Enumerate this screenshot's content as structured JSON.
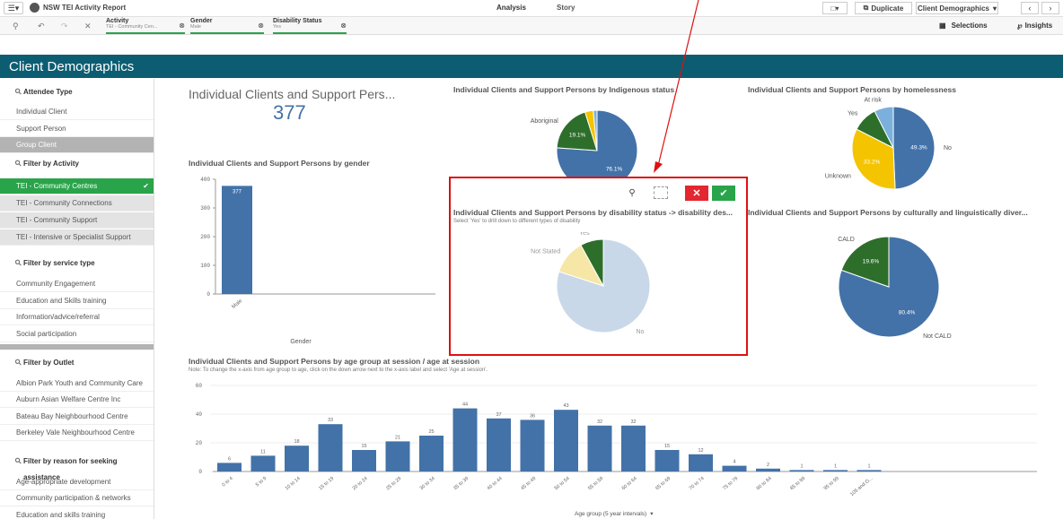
{
  "app": {
    "title": "NSW TEI Activity Report"
  },
  "nav": {
    "tabs": [
      "Analysis",
      "Story"
    ],
    "duplicate": "Duplicate",
    "sheet": "Client Demographics",
    "selections": "Selections",
    "insights": "Insights"
  },
  "selections": [
    {
      "field": "Activity",
      "value": "TEI - Community Cen..."
    },
    {
      "field": "Gender",
      "value": "Male"
    },
    {
      "field": "Disability Status",
      "value": "Yes"
    }
  ],
  "sheet_title": "Client Demographics",
  "sidebar": {
    "attendee_type": {
      "header": "Attendee Type",
      "items": [
        "Individual Client",
        "Support Person",
        "Group Client"
      ]
    },
    "activity": {
      "header": "Filter by Activity",
      "items": [
        "TEI - Community Centres",
        "TEI - Community Connections",
        "TEI - Community Support",
        "TEI - Intensive or Specialist Support"
      ]
    },
    "service_type": {
      "header": "Filter by service type",
      "items": [
        "Community Engagement",
        "Education and Skills training",
        "Information/advice/referral",
        "Social participation"
      ]
    },
    "outlet": {
      "header": "Filter by Outlet",
      "items": [
        "Albion Park Youth and Community Care",
        "Auburn Asian Welfare Centre Inc",
        "Bateau Bay Neighbourhood Centre",
        "Berkeley Vale Neighbourhood Centre"
      ]
    },
    "reason": {
      "header": "Filter by reason for seeking assistance",
      "items": [
        "Age-appropriate development",
        "Community participation & networks",
        "Education and skills training"
      ]
    }
  },
  "kpi": {
    "title": "Individual Clients and Support Pers...",
    "value": "377"
  },
  "gender_chart": {
    "title": "Individual Clients and Support Persons by gender",
    "xlabel": "Gender"
  },
  "indigenous": {
    "title": "Individual Clients and Support Persons by Indigenous status"
  },
  "homeless": {
    "title": "Individual Clients and Support Persons by homelessness"
  },
  "disability": {
    "title": "Individual Clients and Support Persons by disability status -> disability des...",
    "note": "Select 'Yes' to drill down to different types of disability"
  },
  "cald": {
    "title": "Individual Clients and Support Persons by culturally and linguistically diver..."
  },
  "age_chart": {
    "title": "Individual Clients and Support Persons by age group at session / age at session",
    "note": "Note: To change the x-axis from age group to age, click on the down arrow next to the x-axis label and select 'Age at session'.",
    "xlabel": "Age group (5 year intervals)"
  },
  "colors": {
    "blue": "#4372a8",
    "green": "#2e6e2b",
    "yellow": "#f5c400",
    "lightblue": "#7ab0db",
    "teal": "#0c5d72",
    "pale": "#c8d8e8",
    "cream": "#f6e7a6",
    "red": "#e3262f",
    "ok": "#2aa44b"
  },
  "chart_data": [
    {
      "type": "bar",
      "title": "Individual Clients and Support Persons by gender",
      "categories": [
        "Male"
      ],
      "values": [
        377
      ],
      "xlabel": "Gender",
      "ylim": [
        0,
        400
      ],
      "yticks": [
        0,
        100,
        200,
        300,
        400
      ]
    },
    {
      "type": "pie",
      "title": "Individual Clients and Support Persons by Indigenous status",
      "slices": [
        {
          "label": "",
          "value": 76.1,
          "color": "#4372a8"
        },
        {
          "label": "Aboriginal",
          "value": 19.1,
          "color": "#2e6e2b"
        },
        {
          "label": "",
          "value": 3.3,
          "color": "#f5c400"
        },
        {
          "label": "",
          "value": 1.5,
          "color": "#7ab0db"
        }
      ],
      "slice_labels": [
        "76.1%",
        "19.1%"
      ]
    },
    {
      "type": "pie",
      "title": "Individual Clients and Support Persons by homelessness",
      "slices": [
        {
          "label": "No",
          "value": 49.3,
          "color": "#4372a8"
        },
        {
          "label": "Unknown",
          "value": 33.2,
          "color": "#f5c400"
        },
        {
          "label": "Yes",
          "value": 10.0,
          "color": "#2e6e2b"
        },
        {
          "label": "At risk",
          "value": 7.5,
          "color": "#7ab0db"
        }
      ],
      "slice_labels": [
        "49.3%",
        "33.2%"
      ]
    },
    {
      "type": "pie",
      "title": "Individual Clients and Support Persons by disability status -> disability des...",
      "slices": [
        {
          "label": "No",
          "value": 80.0,
          "color": "#c8d8e8"
        },
        {
          "label": "Not Stated",
          "value": 12.0,
          "color": "#f6e7a6"
        },
        {
          "label": "Yes",
          "value": 8.0,
          "color": "#2e6e2b"
        }
      ]
    },
    {
      "type": "pie",
      "title": "Individual Clients and Support Persons by culturally and linguistically diver...",
      "slices": [
        {
          "label": "Not CALD",
          "value": 80.4,
          "color": "#4372a8"
        },
        {
          "label": "CALD",
          "value": 19.6,
          "color": "#2e6e2b"
        }
      ],
      "slice_labels": [
        "80.4%",
        "19.6%"
      ]
    },
    {
      "type": "bar",
      "title": "Individual Clients and Support Persons by age group at session / age at session",
      "xlabel": "Age group (5 year intervals)",
      "ylim": [
        0,
        60
      ],
      "yticks": [
        0,
        20,
        40,
        60
      ],
      "categories": [
        "0 to 4",
        "5 to 9",
        "10 to 14",
        "15 to 19",
        "20 to 24",
        "25 to 29",
        "30 to 34",
        "35 to 39",
        "40 to 44",
        "45 to 49",
        "50 to 54",
        "55 to 59",
        "60 to 64",
        "65 to 69",
        "70 to 74",
        "75 to 79",
        "80 to 84",
        "85 to 89",
        "95 to 99",
        "105 and O..."
      ],
      "values": [
        6,
        11,
        18,
        33,
        15,
        21,
        25,
        44,
        37,
        36,
        43,
        32,
        32,
        15,
        12,
        4,
        2,
        1,
        1,
        1
      ]
    }
  ]
}
